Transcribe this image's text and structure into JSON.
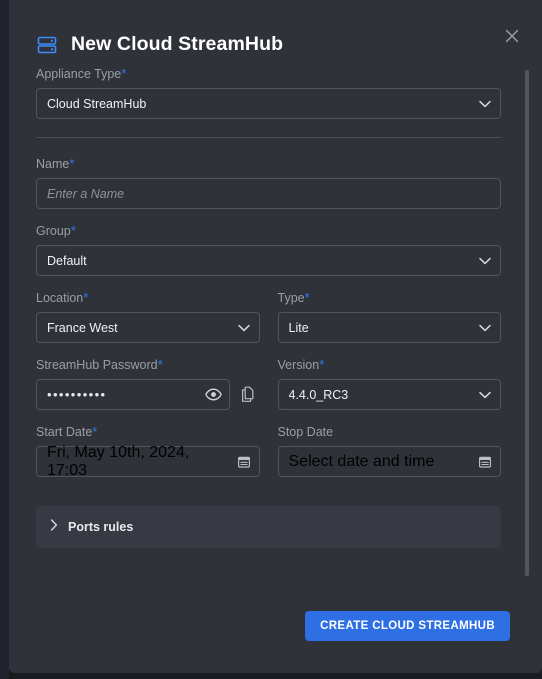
{
  "window": {
    "backdrop_color": "#191b21"
  },
  "modal": {
    "title": "New Cloud StreamHub",
    "title_icon": "server-stack-icon",
    "close_icon": "close-icon",
    "background_color": "#303239",
    "accent_color": "#2f6fe4"
  },
  "form": {
    "appliance_type": {
      "label": "Appliance Type",
      "required_marker": "*",
      "value": "Cloud StreamHub",
      "icon": "chevron-down-icon"
    },
    "name": {
      "label": "Name",
      "required_marker": "*",
      "value": "",
      "placeholder": "Enter a Name"
    },
    "group": {
      "label": "Group",
      "required_marker": "*",
      "value": "Default",
      "icon": "chevron-down-icon"
    },
    "location": {
      "label": "Location",
      "required_marker": "*",
      "value": "France West",
      "icon": "chevron-down-icon"
    },
    "type": {
      "label": "Type",
      "required_marker": "*",
      "value": "Lite",
      "icon": "chevron-down-icon"
    },
    "password": {
      "label": "StreamHub Password",
      "required_marker": "*",
      "masked_value": "••••••••••",
      "reveal_icon": "eye-icon",
      "copy_icon": "copy-icon"
    },
    "version": {
      "label": "Version",
      "required_marker": "*",
      "value": "4.4.0_RC3",
      "icon": "chevron-down-icon"
    },
    "start_date": {
      "label": "Start Date",
      "required_marker": "*",
      "value": "Fri, May 10th, 2024, 17:03",
      "icon": "calendar-icon"
    },
    "stop_date": {
      "label": "Stop Date",
      "required_marker": "",
      "value": "",
      "placeholder": "Select date and time",
      "icon": "calendar-icon"
    },
    "ports_rules": {
      "label": "Ports rules",
      "expanded": false,
      "icon": "chevron-right-icon"
    }
  },
  "footer": {
    "submit_label": "CREATE CLOUD STREAMHUB"
  }
}
